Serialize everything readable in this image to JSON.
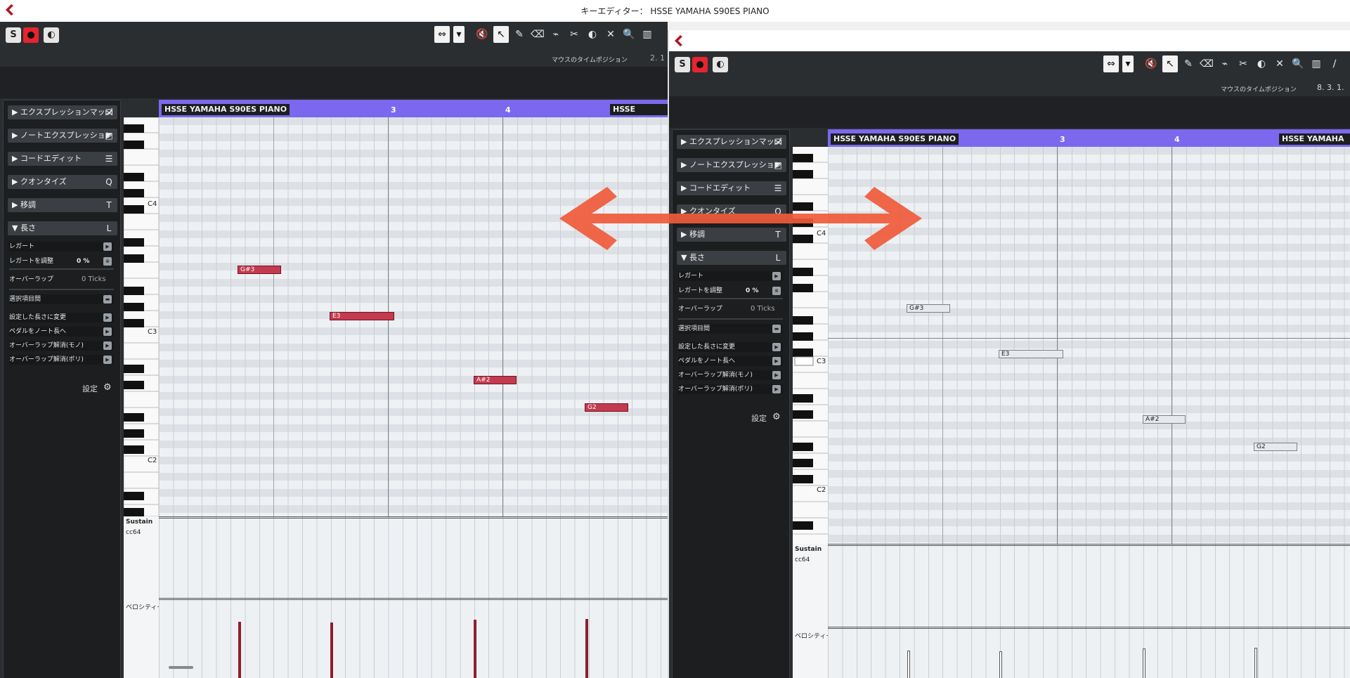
{
  "window_title": "キーエディター： HSSE YAMAHA S90ES PIANO",
  "track_name": "HSSE YAMAHA S90ES PIANO",
  "mouse_pos_label": "マウスのタイムポジション",
  "mouse_pos_left": "2. 1",
  "mouse_pos_right": "8. 3. 1.",
  "bar_numbers": [
    "3",
    "4"
  ],
  "transport": {
    "solo": "S",
    "record": "",
    "loop": "◐"
  },
  "tools": [
    "⇔",
    "▾",
    "🔇",
    "↖",
    "✎",
    "⌫",
    "⌁",
    "✂",
    "◐",
    "✕",
    "🔍",
    "▥",
    "∕"
  ],
  "inspector": {
    "sections": [
      {
        "label": "▶ エクスプレッションマップ",
        "icon": "⋈"
      },
      {
        "label": "▶ ノートエクスプレッション",
        "icon": "◩"
      },
      {
        "label": "▶ コードエディット",
        "icon": "☰"
      },
      {
        "label": "▶ クオンタイズ",
        "icon": "Q"
      },
      {
        "label": "▶ 移調",
        "icon": "T"
      },
      {
        "label": "▼ 長さ",
        "icon": "L"
      }
    ],
    "length_rows": {
      "legato": "レガート",
      "legato_adjust": "レガートを調整",
      "legato_adjust_value": "0 %",
      "overlap": "オーバーラップ",
      "overlap_value": "0 Ticks",
      "between_selected": "選択項目間",
      "set_length": "設定した長さに変更",
      "pedal_to_length": "ペダルをノート長へ",
      "overlap_mono": "オーバーラップ解消(モノ)",
      "overlap_poly": "オーバーラップ解消(ポリ)"
    },
    "settings": "設定"
  },
  "key_labels": [
    "C4",
    "C3",
    "C2"
  ],
  "notes": [
    {
      "pitch": "G#3"
    },
    {
      "pitch": "E3"
    },
    {
      "pitch": "A#2"
    },
    {
      "pitch": "G2"
    }
  ],
  "lanes": {
    "sustain": "Sustain",
    "cc": "cc64",
    "velocity": "ベロシティー"
  },
  "colors": {
    "accent": "#7b68ee",
    "note": "#c23b4f",
    "arrow": "#f05a3a",
    "velocity": "#8e1f2f"
  }
}
